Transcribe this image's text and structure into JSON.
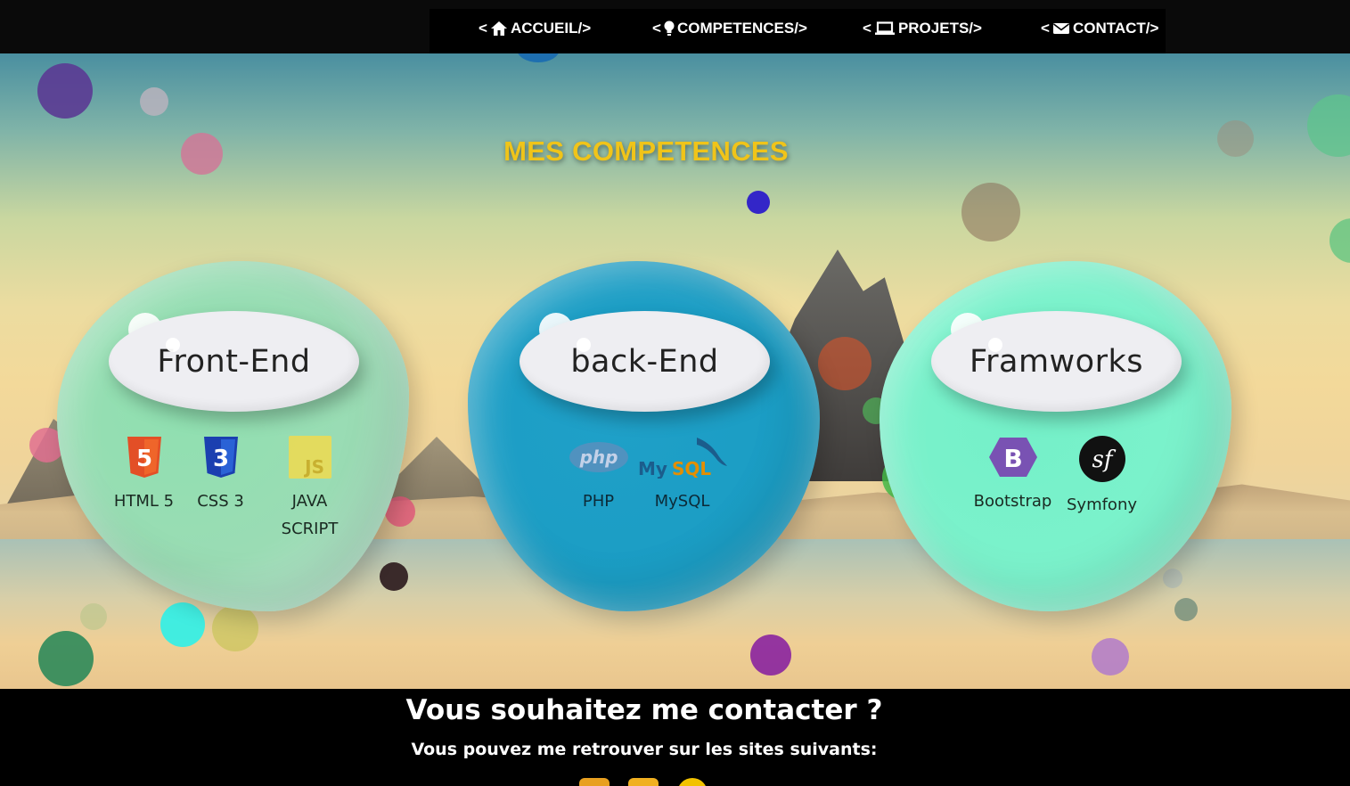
{
  "nav": {
    "items": [
      {
        "label": "ACCUEIL/>",
        "prefix": "<",
        "icon": "home-icon"
      },
      {
        "label": "COMPETENCES/>",
        "prefix": "<",
        "icon": "lightbulb-icon"
      },
      {
        "label": "PROJETS/>",
        "prefix": "<",
        "icon": "laptop-icon"
      },
      {
        "label": "CONTACT/>",
        "prefix": "<",
        "icon": "envelope-icon"
      }
    ]
  },
  "skills_section": {
    "title": "MES COMPETENCES",
    "title_color": "#f0c419",
    "cards": [
      {
        "title": "Front-End",
        "color": "#9adcb4",
        "skills": [
          {
            "label": "HTML 5",
            "icon": "html5-icon"
          },
          {
            "label": "CSS 3",
            "icon": "css3-icon"
          },
          {
            "label": "JAVA SCRIPT",
            "icon": "javascript-icon"
          }
        ]
      },
      {
        "title": "back-End",
        "color": "#1b9dc4",
        "skills": [
          {
            "label": "PHP",
            "icon": "php-icon"
          },
          {
            "label": "MySQL",
            "icon": "mysql-icon"
          }
        ]
      },
      {
        "title": "Framworks",
        "color": "#7cf2cc",
        "skills": [
          {
            "label": "Bootstrap",
            "icon": "bootstrap-icon"
          },
          {
            "label": "Symfony",
            "icon": "symfony-icon"
          }
        ]
      }
    ]
  },
  "contact": {
    "title": "Vous souhaitez me contacter ?",
    "subtitle": "Vous pouvez me retrouver sur les sites suivants:"
  }
}
